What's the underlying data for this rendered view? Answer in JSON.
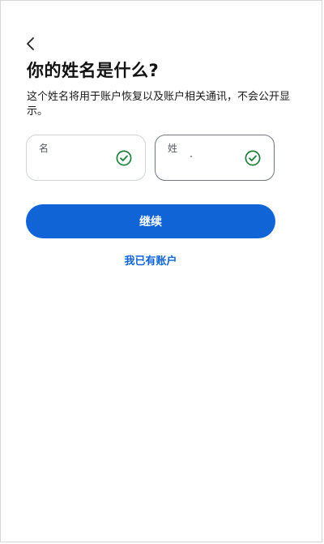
{
  "header": {
    "back_icon": "chevron-left-icon",
    "title": "你的姓名是什么?",
    "subtitle": "这个姓名将用于账户恢复以及账户相关通讯，不会公开显示。"
  },
  "form": {
    "first_name": {
      "label": "名",
      "value": "",
      "status_icon": "check-circle-icon"
    },
    "last_name": {
      "label": "姓",
      "value": "",
      "status_icon": "check-circle-icon"
    }
  },
  "actions": {
    "continue_label": "继续",
    "existing_account_label": "我已有账户"
  },
  "colors": {
    "primary": "#1164d6",
    "success": "#1e7d3a",
    "text": "#111111"
  }
}
